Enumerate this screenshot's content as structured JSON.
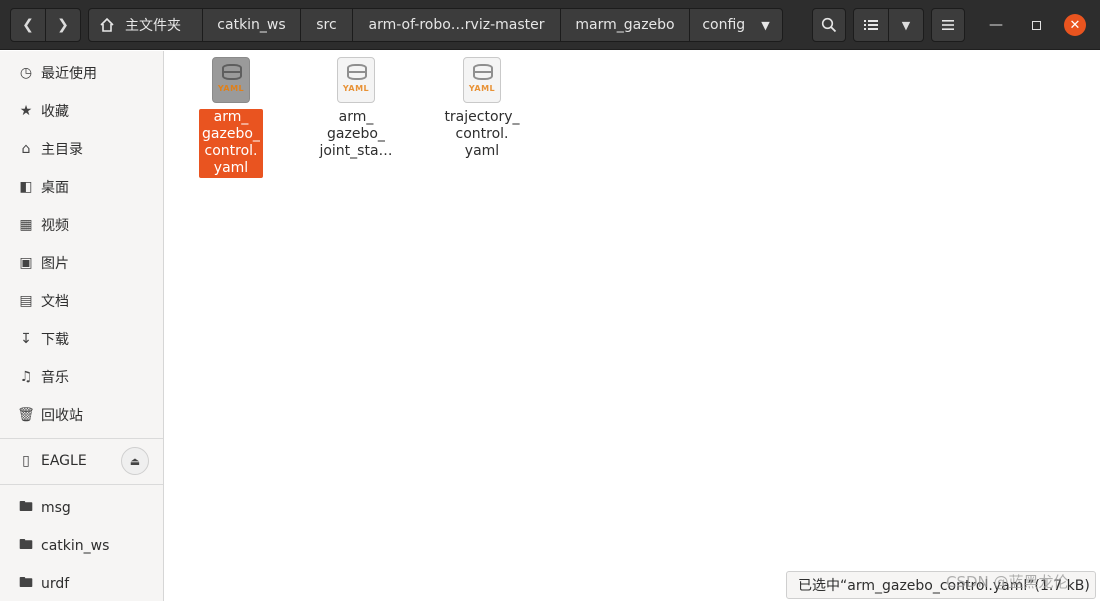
{
  "header": {
    "breadcrumbs": [
      {
        "label": "主文件夹",
        "icon": "home-icon"
      },
      {
        "label": "catkin_ws"
      },
      {
        "label": "src"
      },
      {
        "label": "arm-of-robo…rviz-master"
      },
      {
        "label": "marm_gazebo"
      },
      {
        "label": "config",
        "has_dropdown": true
      }
    ]
  },
  "sidebar": {
    "places": [
      {
        "label": "最近使用",
        "icon": "clock-icon"
      },
      {
        "label": "收藏",
        "icon": "star-icon"
      },
      {
        "label": "主目录",
        "icon": "home-icon"
      },
      {
        "label": "桌面",
        "icon": "desktop-icon"
      },
      {
        "label": "视频",
        "icon": "video-icon"
      },
      {
        "label": "图片",
        "icon": "image-icon"
      },
      {
        "label": "文档",
        "icon": "document-icon"
      },
      {
        "label": "下载",
        "icon": "download-icon"
      },
      {
        "label": "音乐",
        "icon": "music-icon"
      },
      {
        "label": "回收站",
        "icon": "trash-icon"
      }
    ],
    "devices": [
      {
        "label": "EAGLE",
        "icon": "usb-drive-icon"
      }
    ],
    "bookmarks": [
      {
        "label": "msg",
        "icon": "folder-icon"
      },
      {
        "label": "catkin_ws",
        "icon": "folder-icon"
      },
      {
        "label": "urdf",
        "icon": "folder-icon"
      }
    ]
  },
  "files": [
    {
      "label": "arm_\ngazebo_\ncontrol.\nyaml",
      "type_tag": "YAML",
      "selected": true
    },
    {
      "label": "arm_\ngazebo_\njoint_sta…",
      "type_tag": "YAML",
      "selected": false
    },
    {
      "label": "trajectory_\ncontrol.\nyaml",
      "type_tag": "YAML",
      "selected": false
    }
  ],
  "status": {
    "text": "已选中“arm_gazebo_control.yaml”(1.7 kB)"
  },
  "watermark": "CSDN @蓝黑龙伦",
  "colors": {
    "accent": "#e95420",
    "headerbar": "#2d2d2d",
    "sidebar": "#f6f5f4",
    "yaml_tag": "#e89236"
  }
}
